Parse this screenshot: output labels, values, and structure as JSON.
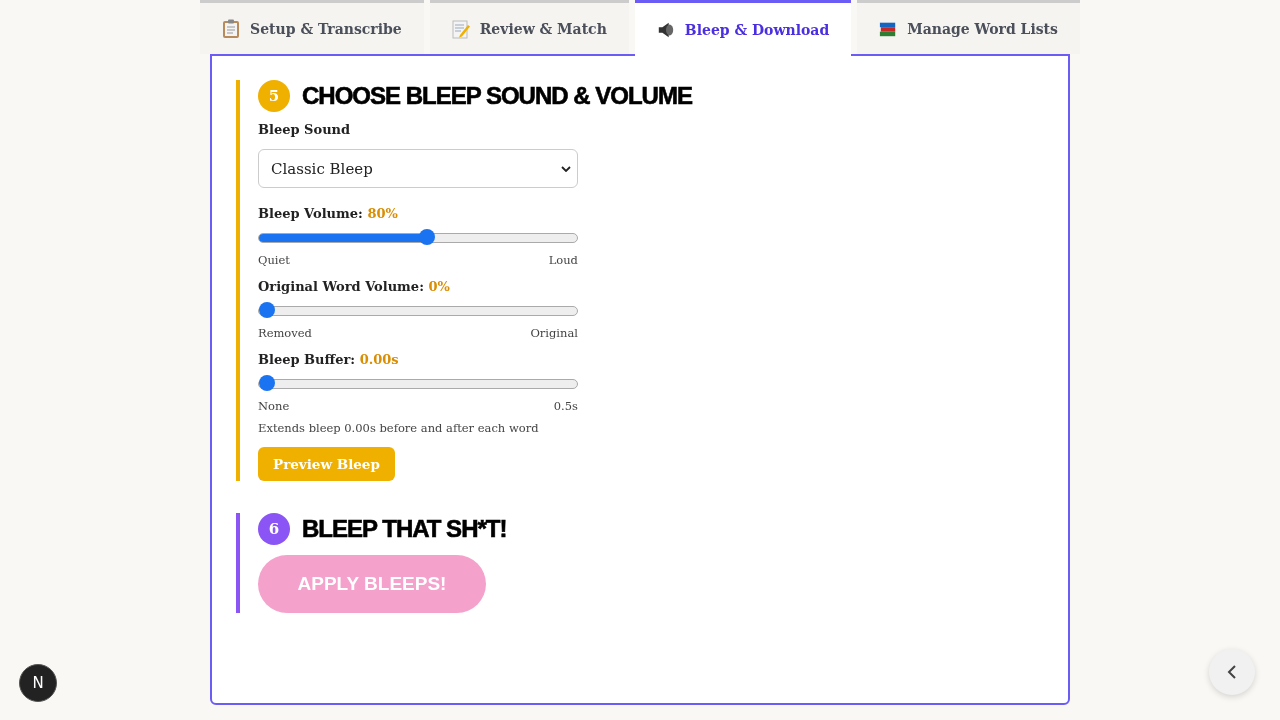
{
  "tabs": [
    {
      "label": "Setup & Transcribe",
      "kind": "clipboard",
      "selected": false
    },
    {
      "label": "Review & Match",
      "kind": "memo",
      "selected": false
    },
    {
      "label": "Bleep & Download",
      "kind": "speaker",
      "selected": true
    },
    {
      "label": "Manage Word Lists",
      "kind": "books",
      "selected": false
    }
  ],
  "sections": [
    {
      "number": "5",
      "title": "CHOOSE BLEEP SOUND & VOLUME",
      "color": "#f0b000",
      "sound": {
        "label": "Bleep Sound",
        "value": "Classic Bleep"
      },
      "sliders": [
        {
          "label": "Bleep Volume:",
          "reading": "80%",
          "level": 0.53,
          "min_label": "Quiet",
          "max_label": "Loud"
        },
        {
          "label": "Original Word Volume:",
          "reading": "0%",
          "level": 0,
          "min_label": "Removed",
          "max_label": "Original"
        },
        {
          "label": "Bleep Buffer:",
          "reading": "0.00s",
          "level": 0,
          "min_label": "None",
          "max_label": "0.5s",
          "hint": "Extends bleep 0.00s before and after each word"
        }
      ],
      "button": {
        "label": "Preview Bleep",
        "kind": "preview",
        "disabled": false
      }
    },
    {
      "number": "6",
      "title": "BLEEP THAT SH*T!",
      "color": "#8b55f5",
      "button": {
        "label": "APPLY BLEEPS!",
        "kind": "apply",
        "disabled": true
      }
    }
  ],
  "dev_badge": "N"
}
